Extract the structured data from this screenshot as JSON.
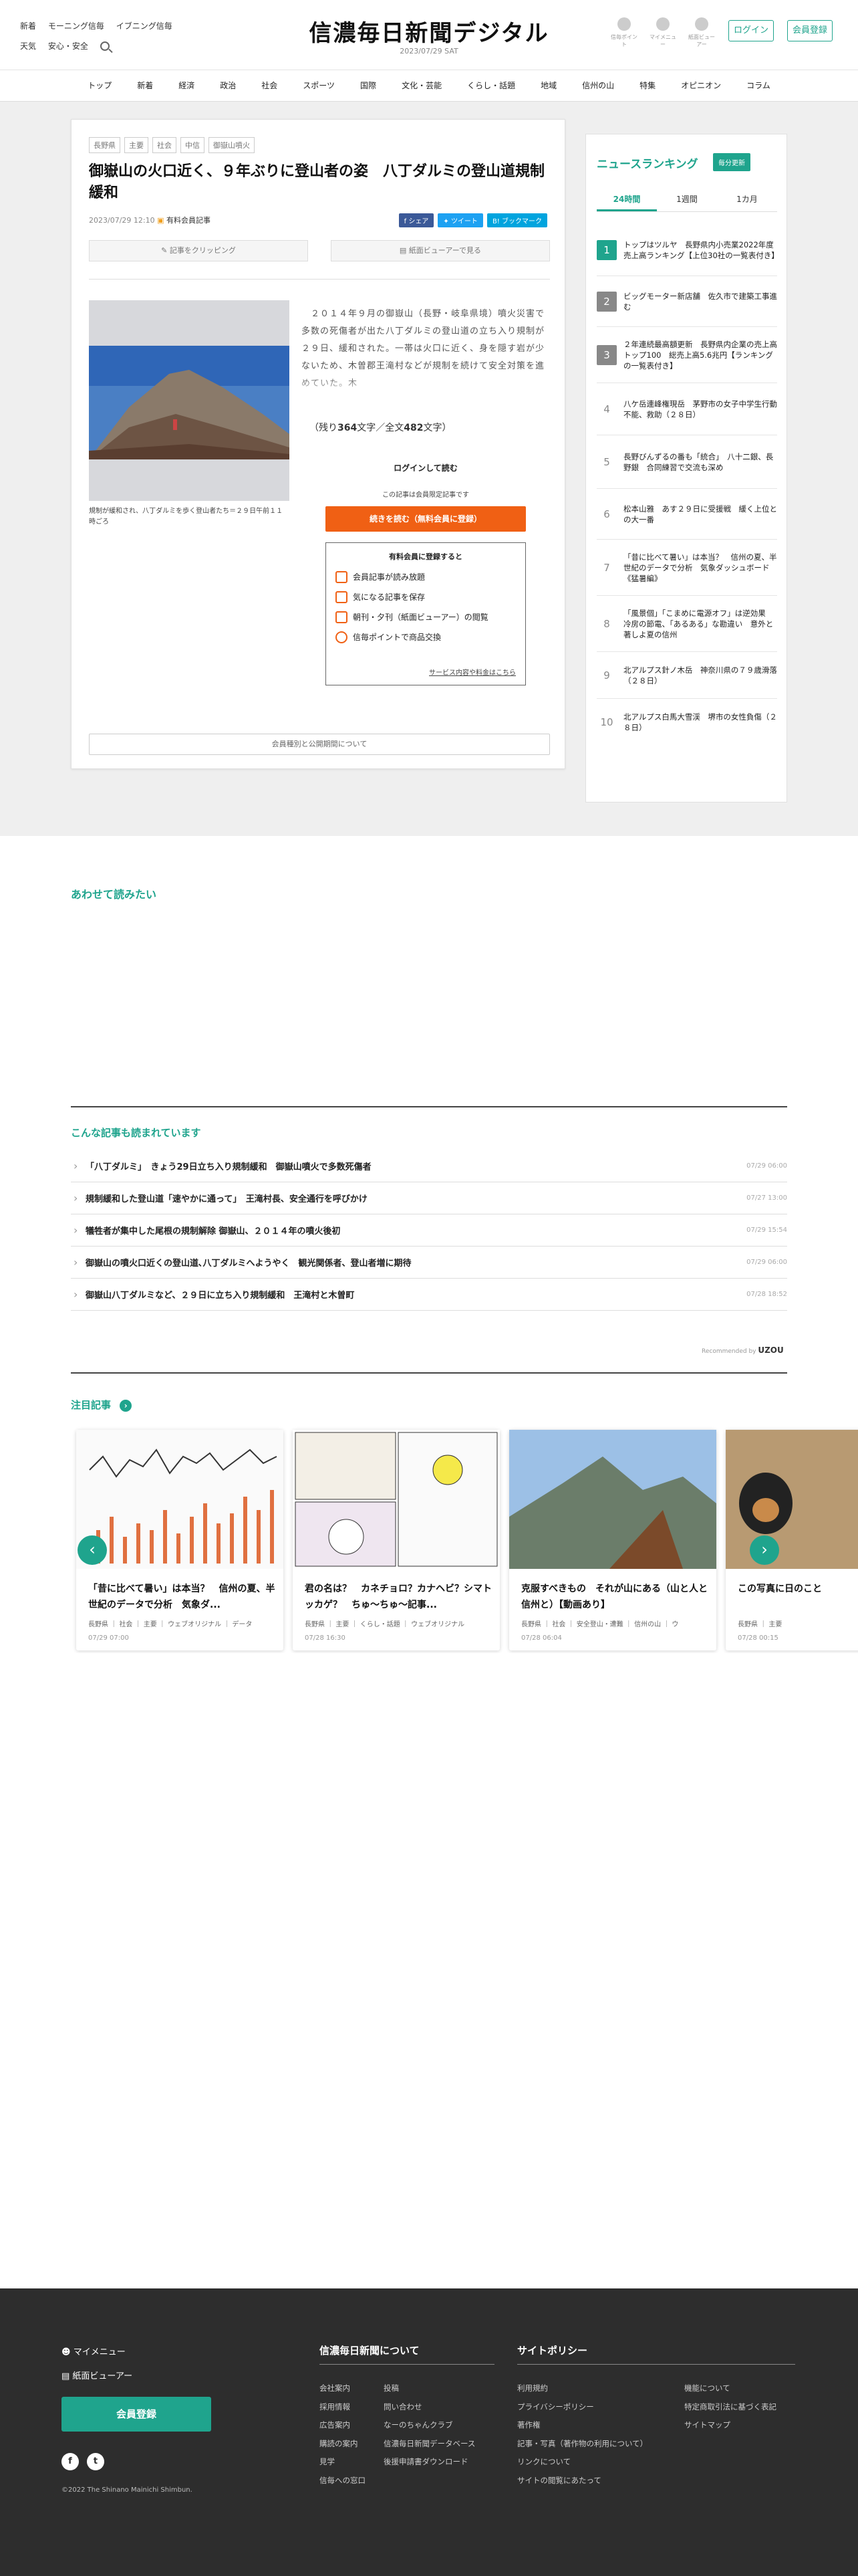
{
  "header": {
    "links_row1": [
      "新着",
      "モーニング信毎",
      "イブニング信毎"
    ],
    "links_row2": [
      "天気",
      "安心・安全"
    ],
    "logo": "信濃毎日新聞デジタル",
    "date": "2023/07/29 SAT",
    "icons": [
      {
        "name": "weather-icon",
        "label": "信毎ポイント"
      },
      {
        "name": "mymenu-icon",
        "label": "マイメニュー"
      },
      {
        "name": "viewer-icon",
        "label": "紙面ビューアー"
      }
    ],
    "login": "ログイン",
    "register": "会員登録"
  },
  "nav": [
    "トップ",
    "新着",
    "経済",
    "政治",
    "社会",
    "スポーツ",
    "国際",
    "文化・芸能",
    "くらし・話題",
    "地域",
    "信州の山",
    "特集",
    "オピニオン",
    "コラム"
  ],
  "article": {
    "tags": [
      "長野県",
      "主要",
      "社会",
      "中信",
      "御嶽山噴火"
    ],
    "title": "御嶽山の火口近く、９年ぶりに登山者の姿　八丁ダルミの登山道規制緩和",
    "datetime": "2023/07/29 12:10",
    "member_label": "有料会員記事",
    "share": "f シェア",
    "tweet": "ツイート",
    "bookmark": "B! ブックマーク",
    "clip": "記事をクリッピング",
    "viewer": "紙面ビューアーで見る",
    "photo_caption": "規制が緩和され、八丁ダルミを歩く登山者たち＝２９日午前１１時ごろ",
    "body": "　２０１４年９月の御嶽山（長野・岐阜県境）噴火災害で多数の死傷者が出た八丁ダルミの登山道の立ち入り規制が２９日、緩和された。一帯は火口に近く、身を隠す岩が少ないため、木曽郡王滝村などが規制を続けて安全対策を進めていた。木",
    "remain_prefix": "（残り",
    "remain_count": "364",
    "remain_mid": "文字／全文",
    "total_count": "482",
    "remain_suffix": "文字）",
    "login_read": "ログインして読む",
    "limited": "この記事は会員限定記事です",
    "continue": "続きを読む（無料会員に登録）",
    "benefit_title": "有料会員に登録すると",
    "benefits": [
      "会員記事が読み放題",
      "気になる記事を保存",
      "朝刊・夕刊（紙面ビューアー）の閲覧",
      "信毎ポイントで商品交換"
    ],
    "service_link": "サービス内容や料金はこちら",
    "member_note": "会員種別と公開期間について"
  },
  "ranking": {
    "title": "ニュースランキング",
    "update": "毎分更新",
    "tabs": [
      "24時間",
      "1週間",
      "1カ月"
    ],
    "items": [
      {
        "num": "1",
        "text": "トップはツルヤ　長野県内小売業2022年度売上高ランキング【上位30社の一覧表付き】"
      },
      {
        "num": "2",
        "text": "ビッグモーター新店舗　佐久市で建築工事進む"
      },
      {
        "num": "3",
        "text": "２年連続最高額更新　長野県内企業の売上高トップ100　総売上高5.6兆円【ランキングの一覧表付き】"
      },
      {
        "num": "4",
        "text": "八ケ岳連峰権現岳　茅野市の女子中学生行動不能、救助（２８日）"
      },
      {
        "num": "5",
        "text": "長野びんずるの番も「統合」　八十二銀、長野銀　合同練習で交流も深め"
      },
      {
        "num": "6",
        "text": "松本山雅　あす２９日に受援戦　緩く上位との大一番"
      },
      {
        "num": "7",
        "text": "「昔に比べて暑い」は本当？　信州の夏、半世紀のデータで分析　気象ダッシュボード《猛暑編》"
      },
      {
        "num": "8",
        "text": "「風景個」「こまめに電源オフ」は逆効果　冷房の節電、「あるある」な勘違い　意外と著しよ夏の信州"
      },
      {
        "num": "9",
        "text": "北アルプス針ノ木岳　神奈川県の７９歳滑落（２８日）"
      },
      {
        "num": "10",
        "text": "北アルプス白馬大雪渓　堺市の女性負傷（２８日）"
      }
    ]
  },
  "readalso": {
    "title": "あわせて読みたい"
  },
  "popular": {
    "title": "こんな記事も読まれています",
    "items": [
      {
        "text": "「八丁ダルミ」　きょう29日立ち入り規制緩和　御嶽山噴火で多数死傷者",
        "date": "07/29 06:00"
      },
      {
        "text": "規制緩和した登山道「速やかに通って」　王滝村長、安全通行を呼びかけ",
        "date": "07/27 13:00"
      },
      {
        "text": "犠牲者が集中した尾根の規制解除 御嶽山、２０１４年の噴火後初",
        "date": "07/29 15:54"
      },
      {
        "text": "御嶽山の噴火口近くの登山道､八丁ダルミへようやく　観光関係者、登山者増に期待",
        "date": "07/29 06:00"
      },
      {
        "text": "御嶽山八丁ダルミなど、２９日に立ち入り規制緩和　王滝村と木曽町",
        "date": "07/28 18:52"
      }
    ],
    "recommended": "Recommended by",
    "uzou": "UZOU"
  },
  "attention": {
    "title": "注目記事",
    "cards": [
      {
        "title": "「昔に比べて暑い」は本当？　信州の夏、半世紀のデータで分析　気象ダ...",
        "meta": "長野県 ｜ 社会 ｜ 主要 ｜ ウェブオリジナル ｜ データ",
        "date": "07/29 07:00"
      },
      {
        "title": "君の名は？　カネチョロ？カナヘビ？シマトッカゲ？　ちゅ〜ちゅ〜記事...",
        "meta": "長野県 ｜ 主要 ｜ くらし・話題 ｜ ウェブオリジナル",
        "date": "07/28 16:30"
      },
      {
        "title": "克服すべきもの　それが山にある（山と人と信州と）【動画あり】",
        "meta": "長野県 ｜ 社会 ｜ 安全登山・遭難 ｜ 信州の山 ｜ ウ",
        "date": "07/28 06:04"
      },
      {
        "title": "この写真に日のこと",
        "meta": "長野県 ｜ 主要",
        "date": "07/28 00:15"
      }
    ]
  },
  "footer": {
    "mymenu": "マイメニュー",
    "viewer": "紙面ビューアー",
    "register": "会員登録",
    "copyright": "©2022 The Shinano Mainichi Shimbun.",
    "about_title": "信濃毎日新聞について",
    "about_col1": [
      "会社案内",
      "採用情報",
      "広告案内",
      "購読の案内",
      "見学",
      "信毎への窓口"
    ],
    "about_col2": [
      "投稿",
      "問い合わせ",
      "なーのちゃんクラブ",
      "信濃毎日新聞データベース",
      "後援申請書ダウンロード"
    ],
    "policy_title": "サイトポリシー",
    "policy_col1": [
      "利用規約",
      "プライバシーポリシー",
      "著作権",
      "記事・写真（著作物の利用について）",
      "リンクについて",
      "サイトの閲覧にあたって"
    ],
    "policy_col2": [
      "機能について",
      "特定商取引法に基づく表記",
      "サイトマップ"
    ]
  },
  "colors": {
    "accent": "#1fa48d",
    "orange": "#f06014",
    "footer": "#2d2d2d"
  }
}
